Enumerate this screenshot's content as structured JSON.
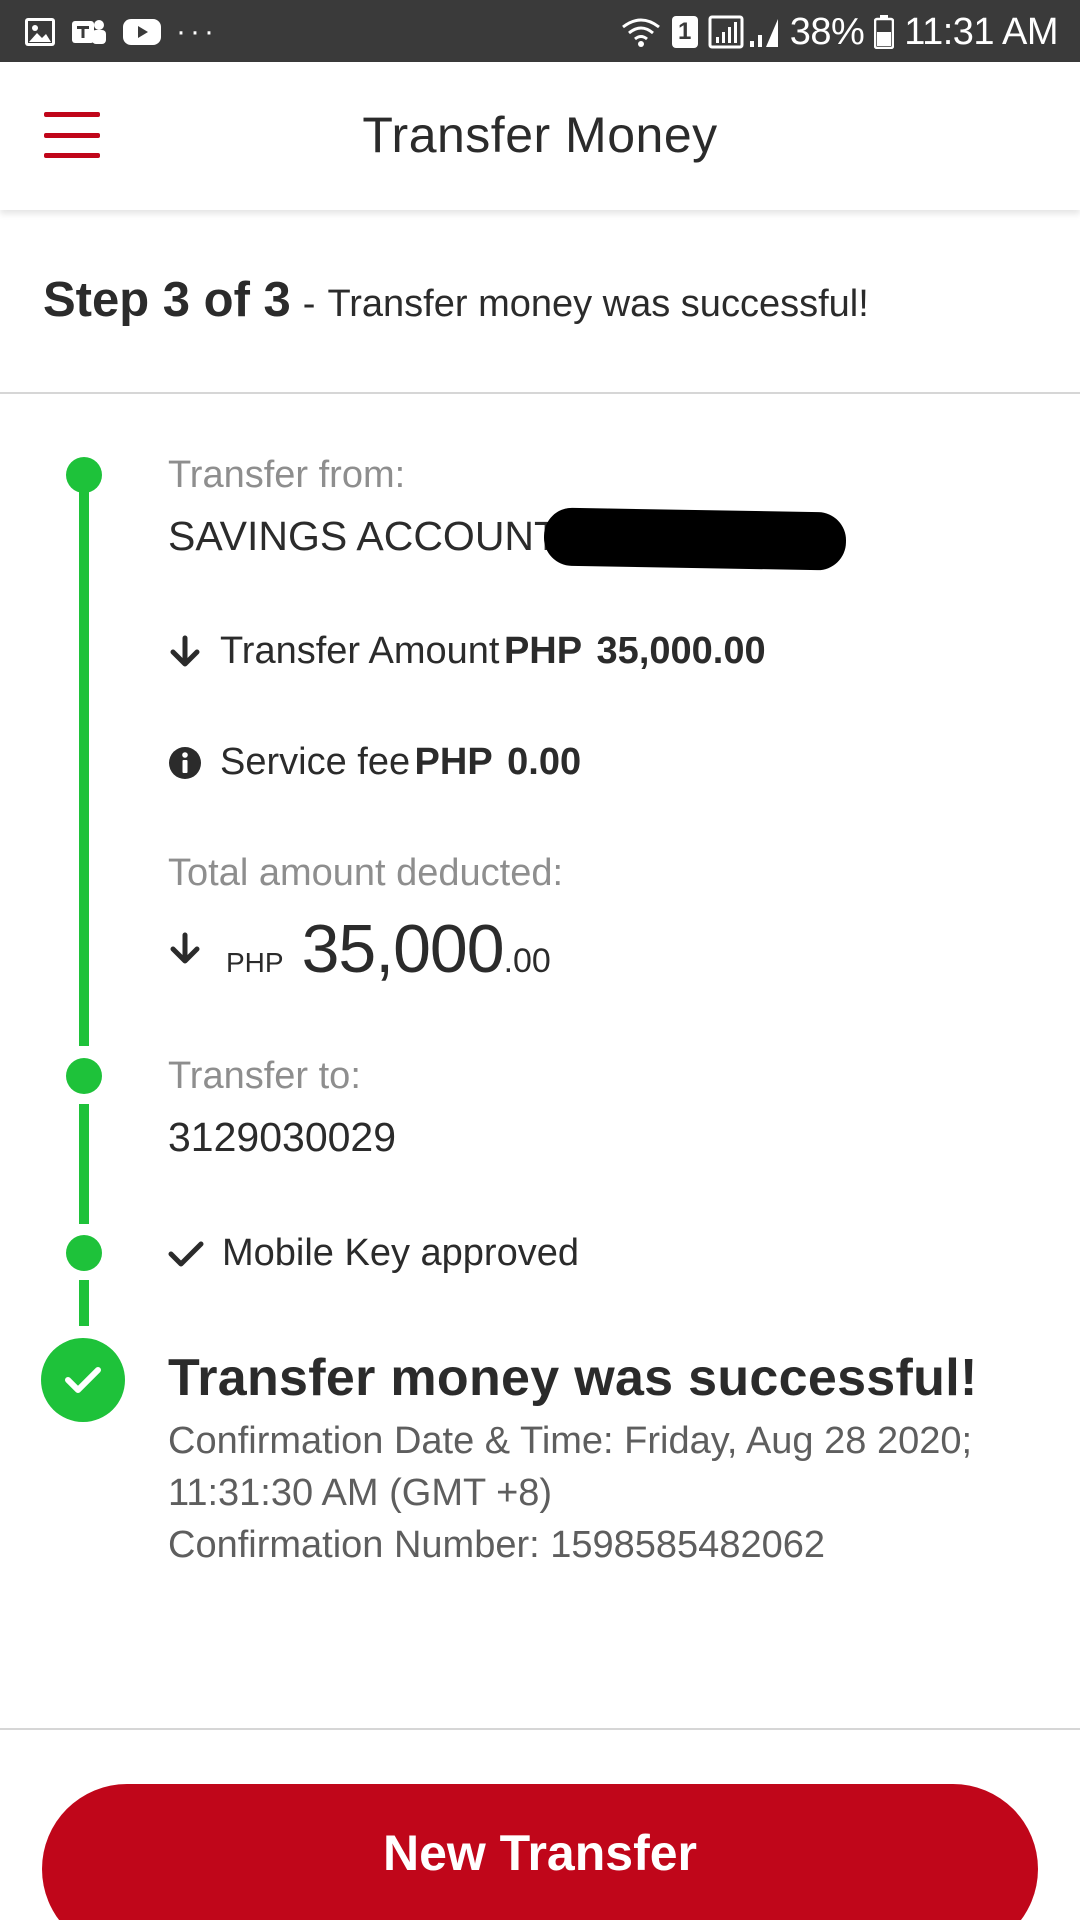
{
  "status_bar": {
    "dots": "···",
    "battery_pct": "38%",
    "time": "11:31 AM",
    "sim_badge": "1"
  },
  "header": {
    "title": "Transfer Money"
  },
  "step": {
    "label": "Step 3 of 3",
    "separator": "-",
    "description": "Transfer money was successful!"
  },
  "transfer_from": {
    "label": "Transfer from:",
    "account": "SAVINGS ACCOUNT |"
  },
  "transfer_amount": {
    "label": "Transfer Amount",
    "currency": "PHP",
    "amount": "35,000.00"
  },
  "service_fee": {
    "label": "Service fee",
    "currency": "PHP",
    "amount": "0.00"
  },
  "total": {
    "label": "Total amount deducted:",
    "currency": "PHP",
    "whole": "35,000",
    "decimal": ".00"
  },
  "transfer_to": {
    "label": "Transfer to:",
    "account": "3129030029"
  },
  "mobile_key": {
    "label": "Mobile Key approved"
  },
  "result": {
    "title": "Transfer money was successful!",
    "confirmation_datetime": "Confirmation Date & Time: Friday, Aug 28 2020;",
    "confirmation_time": "11:31:30 AM (GMT +8)",
    "confirmation_number": "Confirmation Number: 1598585482062"
  },
  "actions": {
    "new_transfer_label": "New Transfer"
  },
  "colors": {
    "brand_red": "#c0061a",
    "success_green": "#1ec23a",
    "status_bar": "#3a3a3a"
  }
}
